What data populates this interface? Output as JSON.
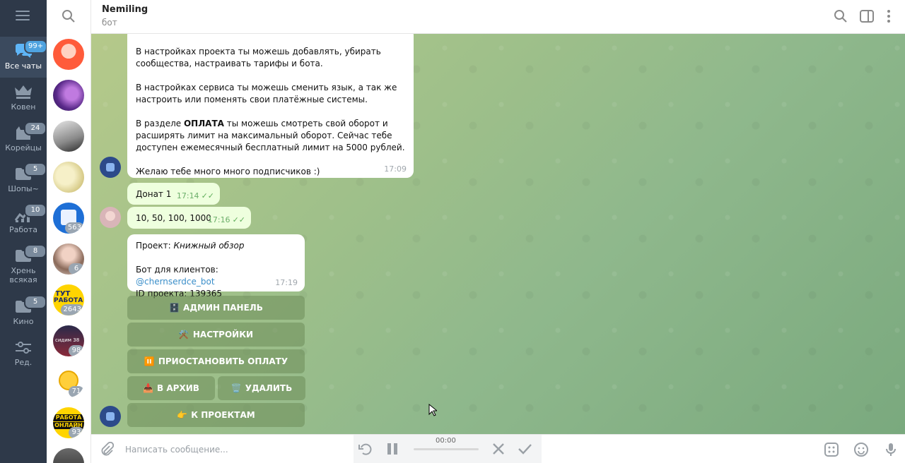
{
  "folders": [
    {
      "label": "Все чаты",
      "badge": "99+",
      "active": true
    },
    {
      "label": "Ковен",
      "badge": ""
    },
    {
      "label": "Корейцы",
      "badge": "24"
    },
    {
      "label": "Шопы~",
      "badge": "5"
    },
    {
      "label": "Работа",
      "badge": "10"
    },
    {
      "label": "Хрень всякая",
      "badge": "8"
    },
    {
      "label": "Кино",
      "badge": "5"
    },
    {
      "label": "Ред.",
      "badge": ""
    }
  ],
  "chats": [
    {
      "badge": ""
    },
    {
      "badge": ""
    },
    {
      "badge": ""
    },
    {
      "badge": ""
    },
    {
      "badge": "563"
    },
    {
      "badge": "6"
    },
    {
      "badge": "2643"
    },
    {
      "badge": "98"
    },
    {
      "badge": "71"
    },
    {
      "badge": "93"
    },
    {
      "badge": ""
    }
  ],
  "avatar_texts": {
    "rabota_top": "ТУТ",
    "rabota_bottom": "РАБОТА",
    "sold": "сидим 38",
    "rabota_online_1": "РАБОТА",
    "rabota_online_2": "ОНЛАЙН"
  },
  "header": {
    "title": "Nemiling",
    "subtitle": "бот"
  },
  "messages": {
    "bot_long": {
      "p1": "В настройках проекта ты можешь добавлять, убирать сообщества, настраивать тарифы и бота.",
      "p2": "В настройках сервиса ты можешь сменить язык, а так же настроить или поменять свои платёжные системы.",
      "p3_prefix": "В разделе ",
      "p3_bold": "ОПЛАТА",
      "p3_suffix": " ты можешь смотреть свой оборот и расширять лимит на максимальный оборот. Сейчас тебе доступен ежемесячный бесплатный лимит на 5000 рублей.",
      "p4": "Желаю тебе много много подписчиков :)",
      "time": "17:09"
    },
    "out1": {
      "text": "Донат 1",
      "time": "17:14"
    },
    "out2": {
      "text": "10, 50, 100, 1000",
      "time": "17:16"
    },
    "project": {
      "project_label": "Проект: ",
      "project_name": "Книжный обзор",
      "bot_label": "Бот для клиентов: ",
      "bot_link": "@chernserdce_bot",
      "id_line": "ID проекта: 139365",
      "time": "17:19"
    }
  },
  "keyboard": {
    "admin": {
      "emoji": "🗄️",
      "label": "АДМИН ПАНЕЛЬ"
    },
    "settings": {
      "emoji": "⚒️",
      "label": "НАСТРОЙКИ"
    },
    "pause": {
      "emoji": "⏸️",
      "label": "ПРИОСТАНОВИТЬ ОПЛАТУ"
    },
    "archive": {
      "emoji": "📥",
      "label": "В АРХИВ"
    },
    "delete": {
      "emoji": "🗑️",
      "label": "УДАЛИТЬ"
    },
    "projects": {
      "emoji": "👉",
      "label": "К ПРОЕКТАМ"
    }
  },
  "input": {
    "placeholder": "Написать сообщение...",
    "voice_time": "00:00"
  },
  "icons": {
    "menu": "hamburger-icon",
    "search": "search-icon",
    "sidebar": "sidebar-toggle-icon",
    "more": "more-vertical-icon",
    "attach": "paperclip-icon",
    "commands": "bot-commands-icon",
    "emoji": "emoji-icon",
    "mic": "microphone-icon"
  },
  "colors": {
    "folders_bg": "#2e3949",
    "accent": "#4fa3e0",
    "outgoing_bubble": "#eeffde",
    "link": "#3a8ec9"
  }
}
